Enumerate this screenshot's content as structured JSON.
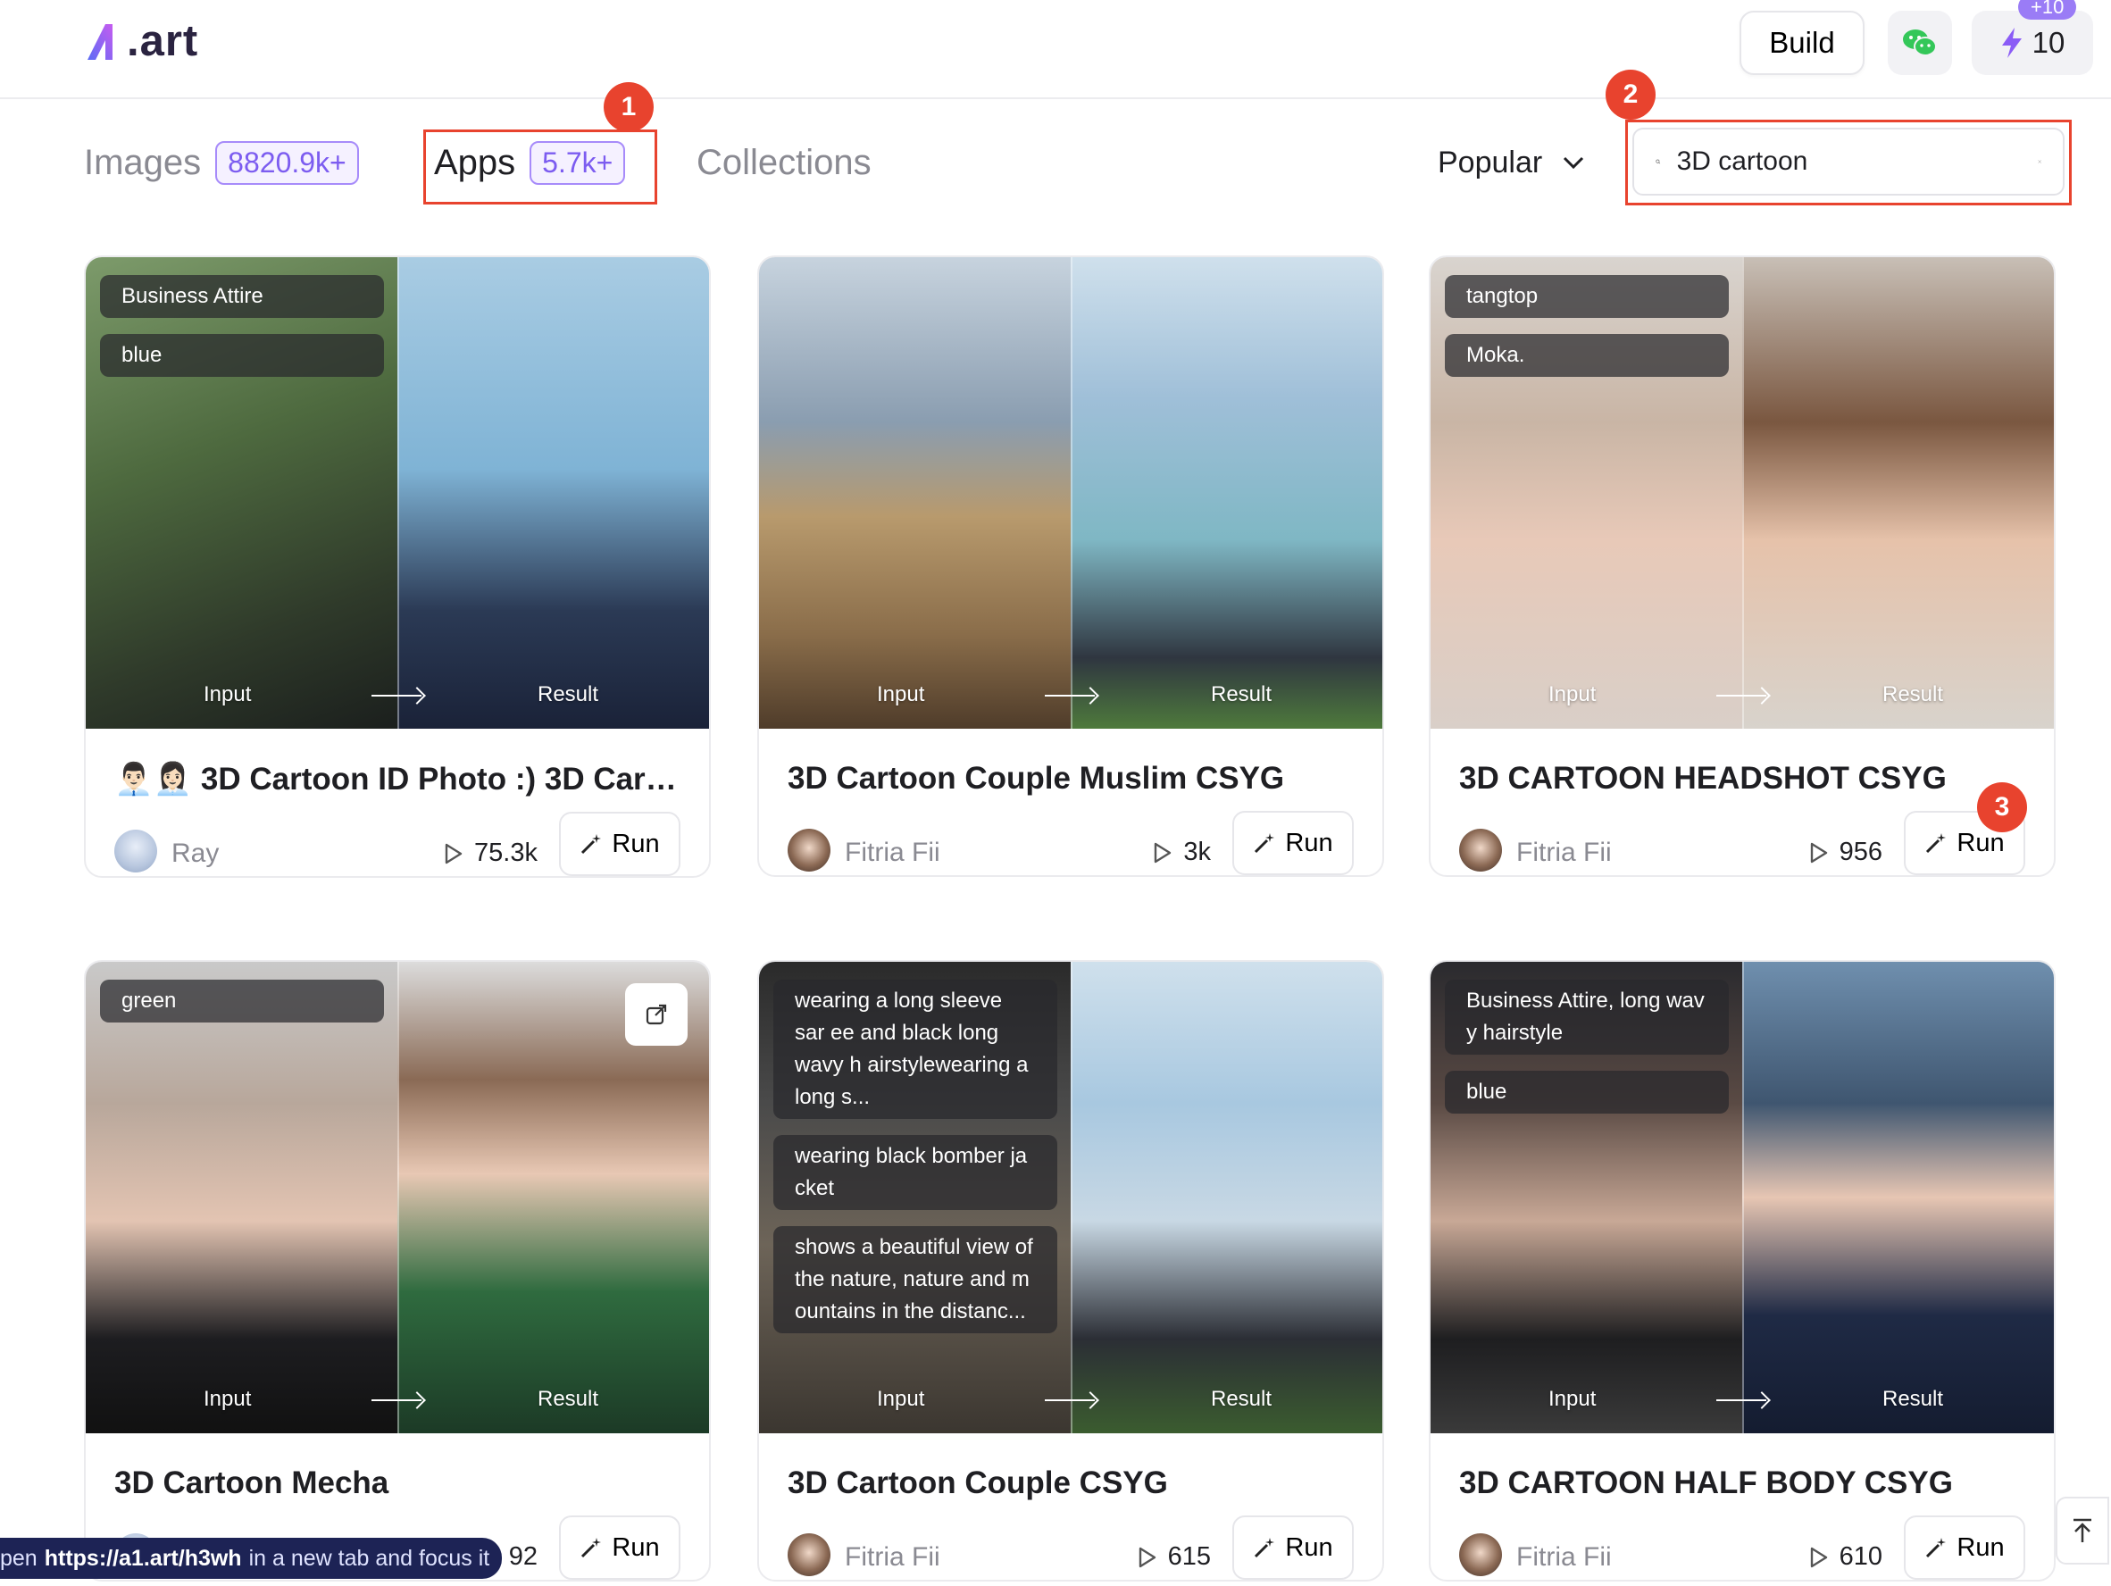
{
  "app": {
    "logo_text": ".art"
  },
  "header": {
    "build_label": "Build",
    "credits_value": "10",
    "credits_badge": "+10"
  },
  "tabs": [
    {
      "label": "Images",
      "count": "8820.9k+"
    },
    {
      "label": "Apps",
      "count": "5.7k+"
    },
    {
      "label": "Collections",
      "count": ""
    }
  ],
  "markers": [
    "1",
    "2",
    "3"
  ],
  "sort": {
    "selected": "Popular"
  },
  "search": {
    "value": "3D cartoon"
  },
  "common": {
    "input_caption": "Input",
    "result_caption": "Result",
    "run_label": "Run"
  },
  "cards": [
    {
      "title": "👨🏻‍💼👩🏻‍💼 3D Cartoon ID Photo :) 3D Cart...",
      "author": "Ray",
      "runs": "75.3k",
      "tags": [
        "Business Attire",
        "blue"
      ]
    },
    {
      "title": "3D Cartoon Couple Muslim CSYG",
      "author": "Fitria Fii",
      "runs": "3k",
      "tags": []
    },
    {
      "title": "3D CARTOON HEADSHOT CSYG",
      "author": "Fitria Fii",
      "runs": "956",
      "tags": [
        "tangtop",
        "Moka."
      ]
    },
    {
      "title": "3D Cartoon Mecha",
      "author": "",
      "runs": "92",
      "tags": [
        "green"
      ]
    },
    {
      "title": "3D Cartoon Couple CSYG",
      "author": "Fitria Fii",
      "runs": "615",
      "tags": [
        "wearing a long sleeve sar ee and black long wavy h airstylewearing a long s...",
        "wearing black bomber ja cket",
        "shows a beautiful view of the nature, nature and m ountains in the distanc..."
      ]
    },
    {
      "title": "3D CARTOON HALF BODY CSYG",
      "author": "Fitria Fii",
      "runs": "610",
      "tags": [
        "Business Attire, long wav y hairstyle",
        "blue"
      ]
    }
  ],
  "status_tooltip": {
    "prefix": "pen",
    "url": "https://a1.art/h3wh",
    "suffix": "in a new tab and focus it"
  },
  "colors": {
    "accent": "#7c5cf0",
    "highlight": "#e8432e"
  }
}
